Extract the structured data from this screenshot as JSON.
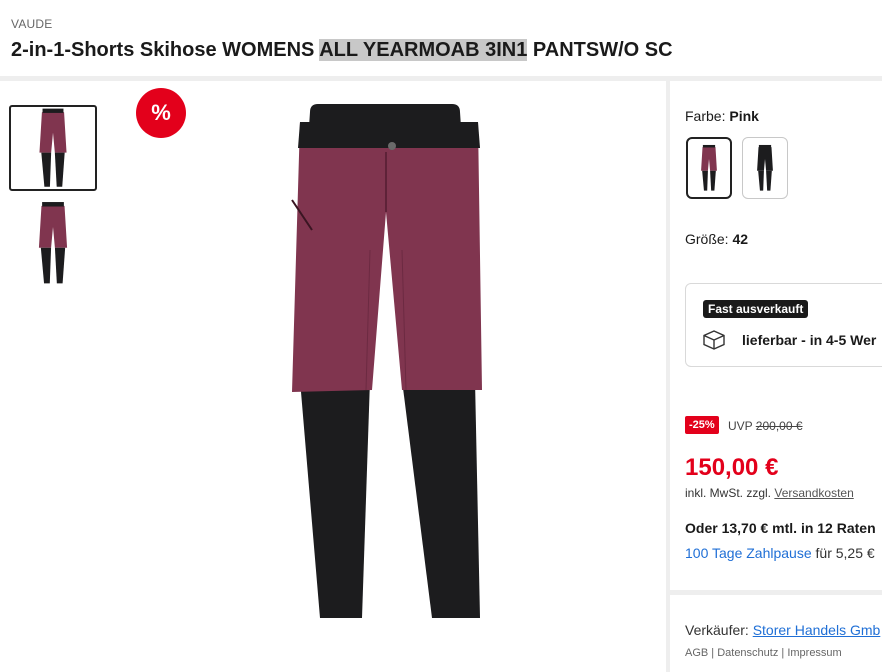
{
  "product": {
    "brand": "VAUDE",
    "title_prefix": "2-in-1-Shorts Skihose WOMENS ",
    "title_highlight": "ALL YEARMOAB 3IN1",
    "title_suffix": " PANTSW/O SC"
  },
  "badge": {
    "label": "%"
  },
  "options": {
    "color_label": "Farbe: ",
    "color_value": "Pink",
    "size_label": "Größe: ",
    "size_value": "42"
  },
  "availability": {
    "badge": "Fast ausverkauft",
    "delivery": "lieferbar - in 4-5 Wer"
  },
  "pricing": {
    "discount": "-25%",
    "uvp_label": "UVP ",
    "uvp_price": "200,00 €",
    "price": "150,00 €",
    "tax_text": "inkl. MwSt. zzgl. ",
    "shipping_link": "Versandkosten",
    "installment": "Oder 13,70 € mtl. in 12 Raten",
    "pause_link": "100 Tage Zahlpause",
    "pause_suffix": " für 5,25 €"
  },
  "seller": {
    "label": "Verkäufer: ",
    "name": "Storer Handels Gmb",
    "legal": "AGB | Datenschutz | Impressum"
  },
  "colors": {
    "accent_red": "#e3001b",
    "link_blue": "#1f6fd6",
    "pants_pink": "#80354f",
    "pants_black": "#1c1c1e"
  }
}
